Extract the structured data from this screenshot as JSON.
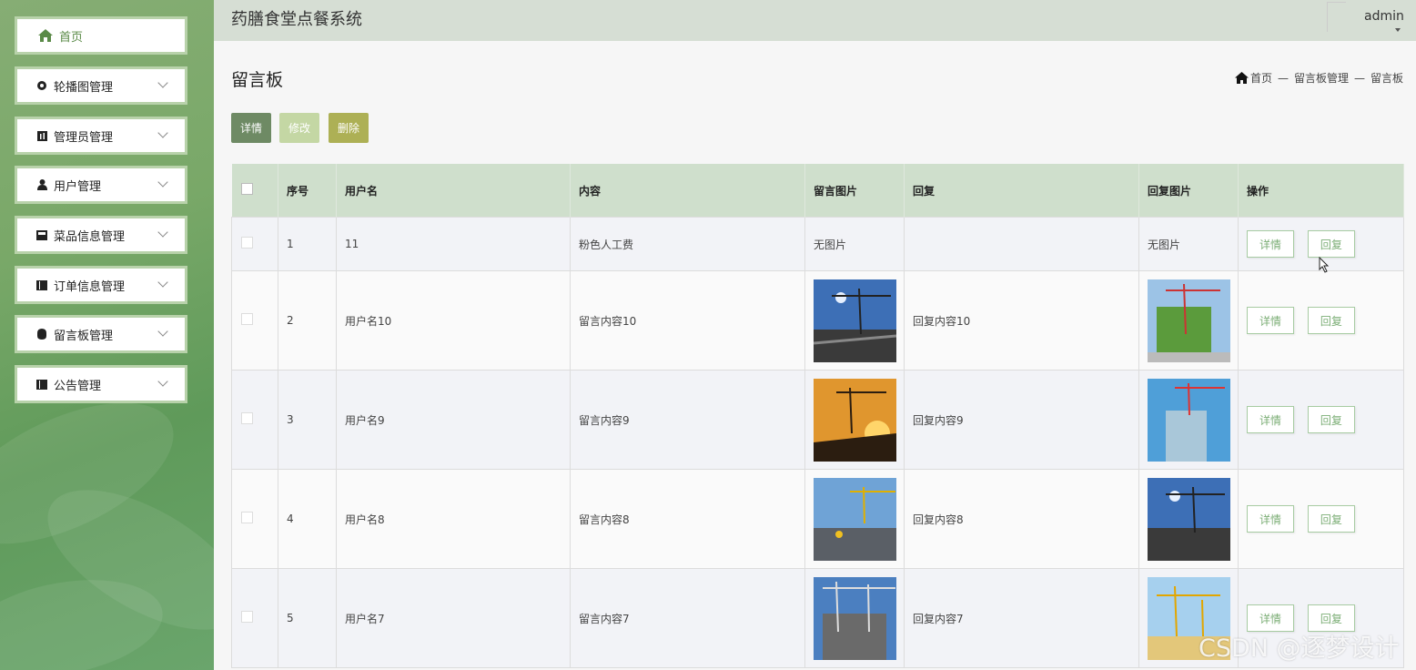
{
  "app": {
    "title": "药膳食堂点餐系统",
    "user": "admin"
  },
  "sidebar": {
    "items": [
      {
        "label": "首页",
        "icon": "home-icon"
      },
      {
        "label": "轮播图管理",
        "icon": "circle-icon"
      },
      {
        "label": "管理员管理",
        "icon": "admin-icon"
      },
      {
        "label": "用户管理",
        "icon": "user-icon"
      },
      {
        "label": "菜品信息管理",
        "icon": "dish-icon"
      },
      {
        "label": "订单信息管理",
        "icon": "book-icon"
      },
      {
        "label": "留言板管理",
        "icon": "message-icon"
      },
      {
        "label": "公告管理",
        "icon": "notice-icon"
      }
    ]
  },
  "page": {
    "title": "留言板"
  },
  "breadcrumb": {
    "home": "首页",
    "level1": "留言板管理",
    "level2": "留言板",
    "sep": "—"
  },
  "toolbar": {
    "detail": "详情",
    "edit": "修改",
    "delete": "删除"
  },
  "colors": {
    "detail_btn": "#6e8a64",
    "edit_btn": "#c4d7a4",
    "delete_btn": "#adb055",
    "header_bg": "#d6ded4",
    "table_header": "#cfdfcc"
  },
  "table": {
    "headers": [
      "序号",
      "用户名",
      "内容",
      "留言图片",
      "回复",
      "回复图片",
      "操作"
    ],
    "rows": [
      {
        "no": "1",
        "username": "11",
        "content": "粉色人工费",
        "image": "无图片",
        "reply": "",
        "reply_image": "无图片"
      },
      {
        "no": "2",
        "username": "用户名10",
        "content": "留言内容10",
        "image": "construction-photo",
        "reply": "回复内容10",
        "reply_image": "construction-photo"
      },
      {
        "no": "3",
        "username": "用户名9",
        "content": "留言内容9",
        "image": "construction-photo",
        "reply": "回复内容9",
        "reply_image": "construction-photo"
      },
      {
        "no": "4",
        "username": "用户名8",
        "content": "留言内容8",
        "image": "construction-photo",
        "reply": "回复内容8",
        "reply_image": "construction-photo"
      },
      {
        "no": "5",
        "username": "用户名7",
        "content": "留言内容7",
        "image": "construction-photo",
        "reply": "回复内容7",
        "reply_image": "construction-photo"
      }
    ],
    "actions": {
      "detail": "详情",
      "reply": "回复"
    }
  },
  "watermark": "CSDN @逐梦设计"
}
